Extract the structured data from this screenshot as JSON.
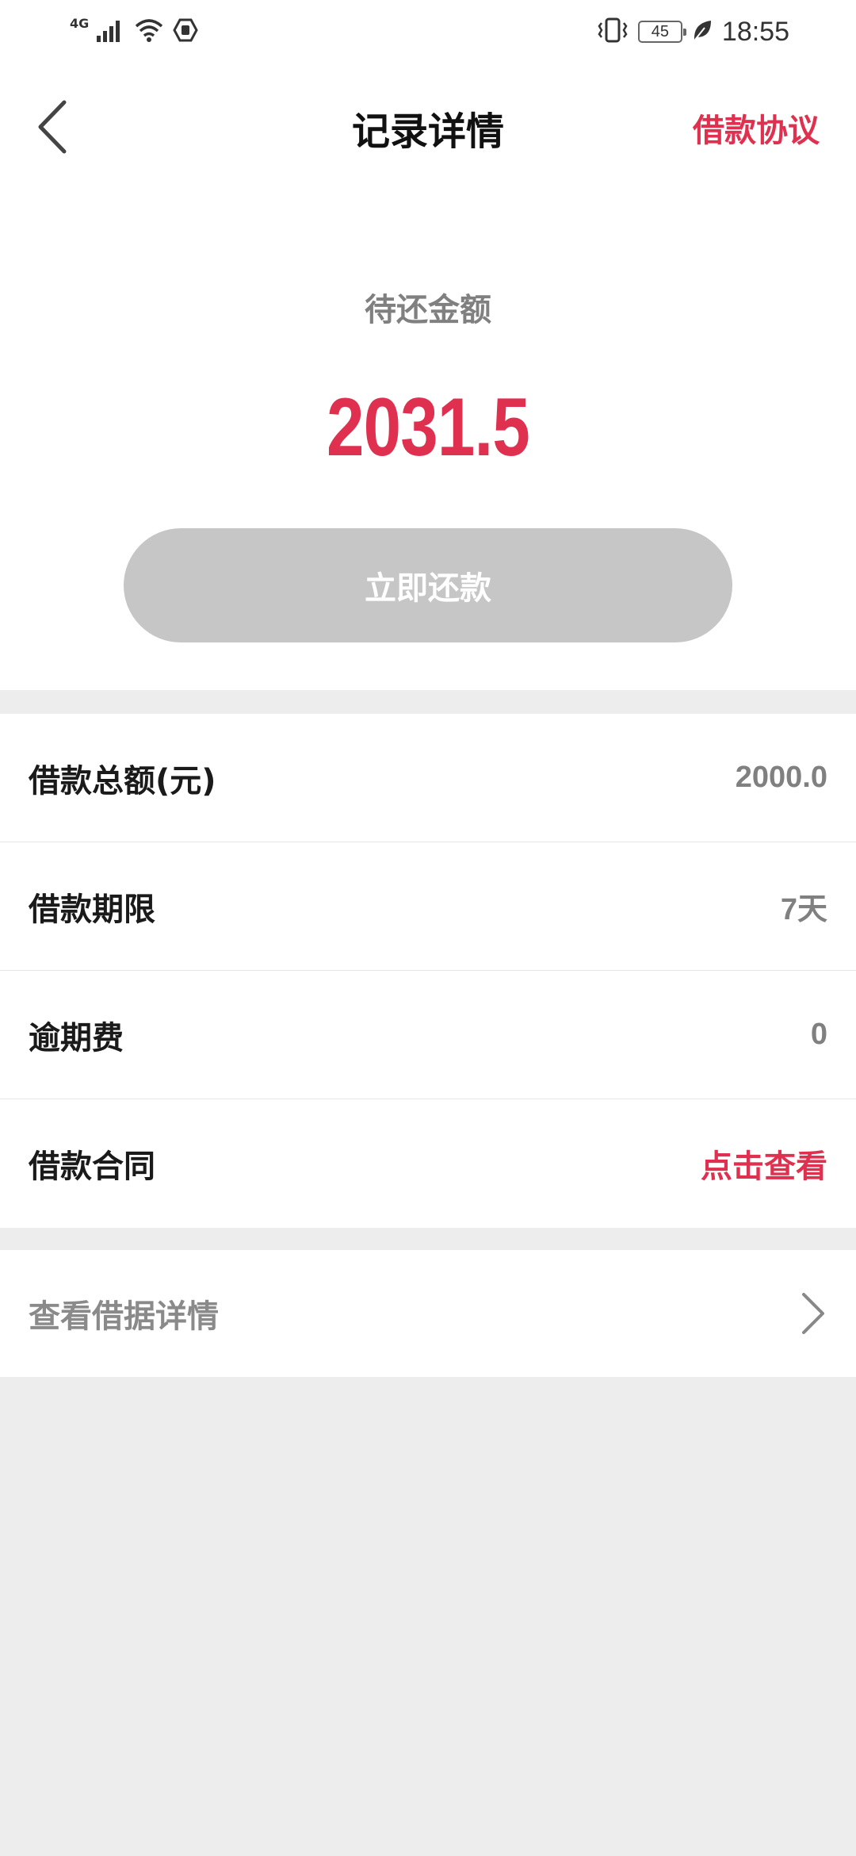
{
  "status_bar": {
    "network_type": "4G",
    "battery_level": "45",
    "time": "18:55",
    "icons": [
      "signal-icon",
      "wifi-icon",
      "hand-icon",
      "vibrate-icon",
      "battery-icon",
      "leaf-icon"
    ]
  },
  "nav": {
    "back_icon": "chevron-left-icon",
    "title": "记录详情",
    "action_label": "借款协议"
  },
  "amount": {
    "label": "待还金额",
    "value": "2031.5",
    "repay_button_label": "立即还款"
  },
  "info_rows": [
    {
      "label": "借款总额(元)",
      "value": "2000.0"
    },
    {
      "label": "借款期限",
      "value": "7天"
    },
    {
      "label": "逾期费",
      "value": "0"
    },
    {
      "label": "借款合同",
      "value": "点击查看"
    }
  ],
  "detail_link": {
    "label": "查看借据详情",
    "icon": "chevron-right-icon"
  },
  "colors": {
    "accent": "#e0304f",
    "button_disabled": "#c6c6c6",
    "background": "#ededed"
  }
}
